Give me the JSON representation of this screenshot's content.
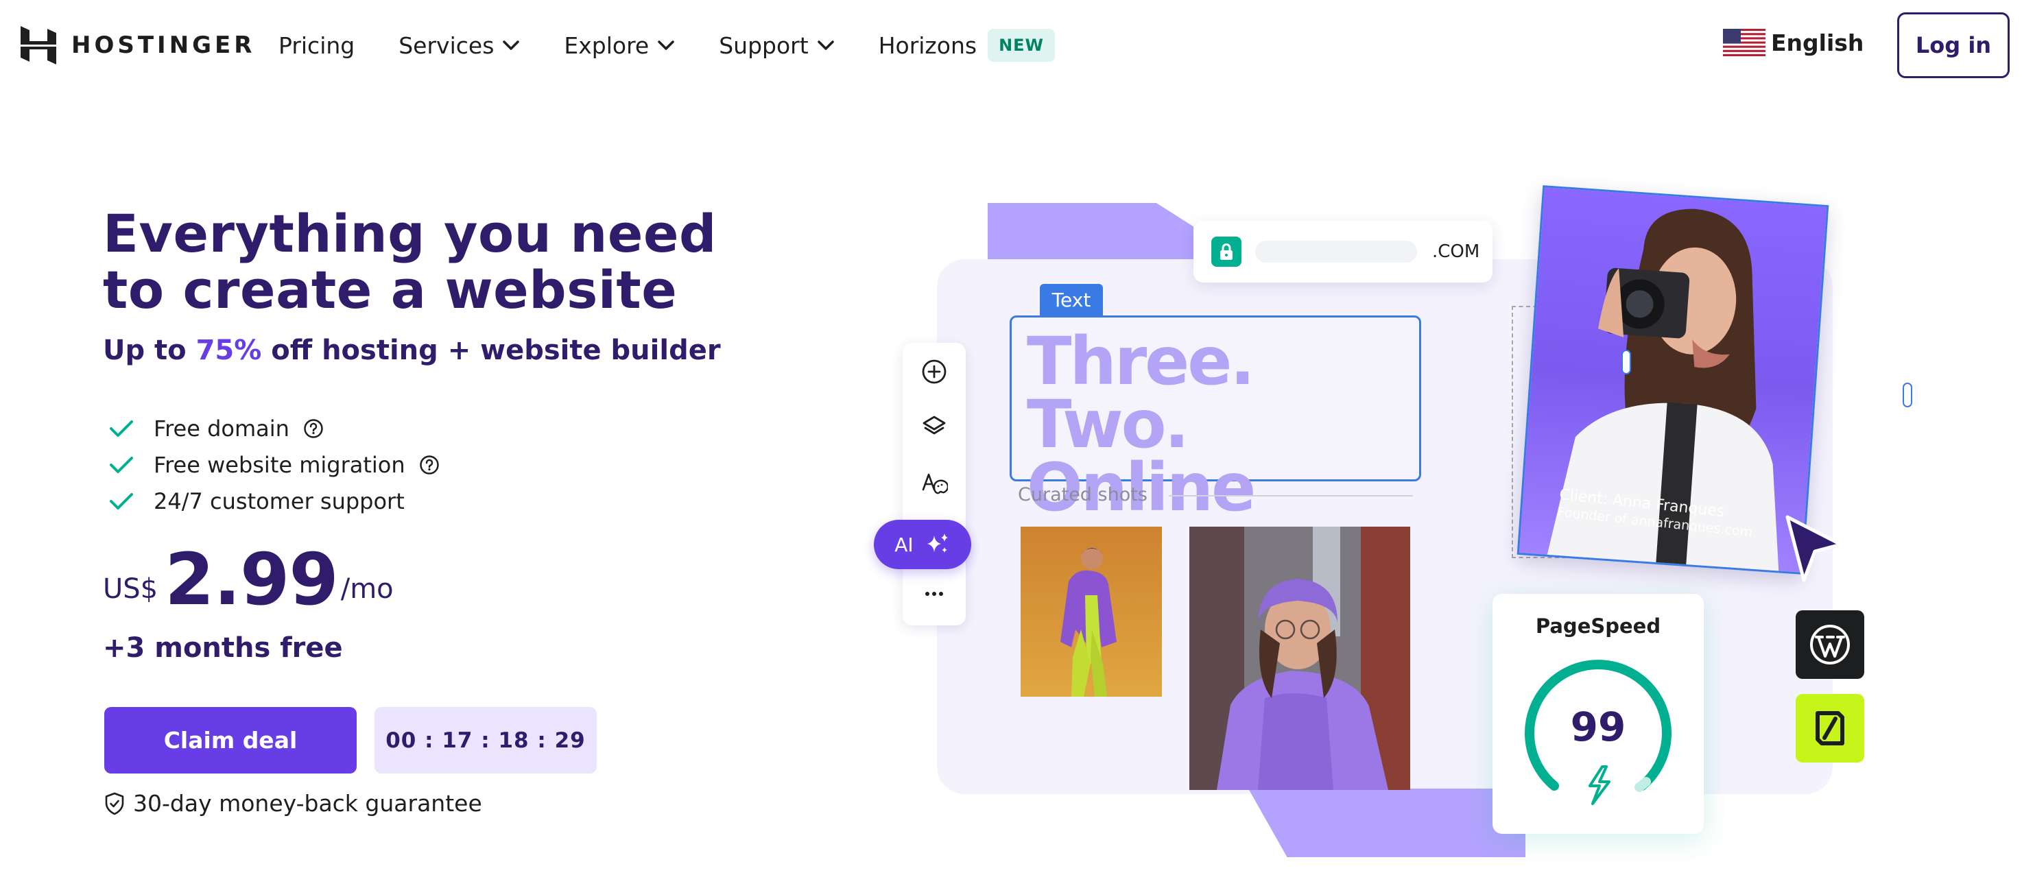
{
  "brand": {
    "name": "HOSTINGER",
    "logo_icon": "hostinger-logo-icon"
  },
  "nav": {
    "items": [
      {
        "label": "Pricing",
        "has_dropdown": false
      },
      {
        "label": "Services",
        "has_dropdown": true
      },
      {
        "label": "Explore",
        "has_dropdown": true
      },
      {
        "label": "Support",
        "has_dropdown": true
      },
      {
        "label": "Horizons",
        "has_dropdown": false,
        "badge": "NEW"
      }
    ],
    "language": {
      "label": "English",
      "flag_icon": "us-flag-icon"
    },
    "login_label": "Log in"
  },
  "hero": {
    "title": "Everything you need to create a website",
    "subtitle_prefix": "Up to ",
    "subtitle_percent": "75%",
    "subtitle_suffix": " off hosting + website builder",
    "features": [
      {
        "label": "Free domain",
        "has_help": true
      },
      {
        "label": "Free website migration",
        "has_help": true
      },
      {
        "label": "24/7 customer support",
        "has_help": false
      }
    ],
    "price": {
      "currency": "US$",
      "amount": "2.99",
      "period": "/mo"
    },
    "bonus": "+3 months free",
    "cta_label": "Claim deal",
    "timer": "00 : 17 : 18 : 29",
    "guarantee": "30-day money-back guarantee"
  },
  "illustration": {
    "url_tld": ".COM",
    "text_chip": "Text",
    "text_box_content": "Three. Two. Online",
    "curated_label": "Curated shots",
    "ai_label": "AI",
    "portrait_caption_name": "Client: Anna Franques",
    "portrait_caption_role": "Founder of annafranques.com",
    "pagespeed_title": "PageSpeed",
    "pagespeed_score": "99",
    "toolbar_icons": [
      "add-icon",
      "layers-icon",
      "typography-palette-icon",
      "ai-sparkle-icon",
      "more-icon"
    ]
  },
  "colors": {
    "primary": "#673de6",
    "dark": "#2f1c6a",
    "lavender": "#b4a3ff",
    "accent_green": "#00b090",
    "selection_blue": "#3a7ae5",
    "lime": "#c6f51a"
  }
}
